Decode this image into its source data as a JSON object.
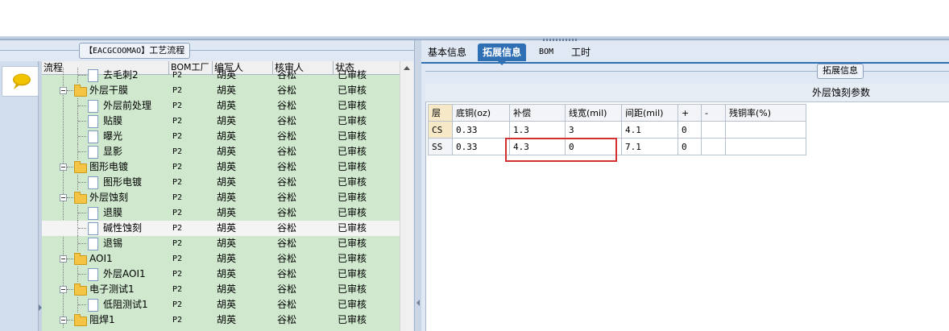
{
  "left_panel": {
    "title_bracket": "【EACGCOOMAO】",
    "title_text": "工艺流程",
    "columns": [
      "流程",
      "BOM工厂",
      "编写人",
      "核审人",
      "状态"
    ],
    "rows": [
      {
        "name": "去毛刺2",
        "level": 2,
        "type": "doc",
        "bom": "P2",
        "writer": "胡英",
        "reviewer": "谷松",
        "status": "已审核"
      },
      {
        "name": "外层干膜",
        "level": 1,
        "type": "folder",
        "bom": "P2",
        "writer": "胡英",
        "reviewer": "谷松",
        "status": "已审核"
      },
      {
        "name": "外层前处理",
        "level": 2,
        "type": "doc",
        "bom": "P2",
        "writer": "胡英",
        "reviewer": "谷松",
        "status": "已审核"
      },
      {
        "name": "贴膜",
        "level": 2,
        "type": "doc",
        "bom": "P2",
        "writer": "胡英",
        "reviewer": "谷松",
        "status": "已审核"
      },
      {
        "name": "曝光",
        "level": 2,
        "type": "doc",
        "bom": "P2",
        "writer": "胡英",
        "reviewer": "谷松",
        "status": "已审核"
      },
      {
        "name": "显影",
        "level": 2,
        "type": "doc",
        "bom": "P2",
        "writer": "胡英",
        "reviewer": "谷松",
        "status": "已审核"
      },
      {
        "name": "图形电镀",
        "level": 1,
        "type": "folder",
        "bom": "P2",
        "writer": "胡英",
        "reviewer": "谷松",
        "status": "已审核"
      },
      {
        "name": "图形电镀",
        "level": 2,
        "type": "doc",
        "bom": "P2",
        "writer": "胡英",
        "reviewer": "谷松",
        "status": "已审核"
      },
      {
        "name": "外层蚀刻",
        "level": 1,
        "type": "folder",
        "bom": "P2",
        "writer": "胡英",
        "reviewer": "谷松",
        "status": "已审核"
      },
      {
        "name": "退膜",
        "level": 2,
        "type": "doc",
        "bom": "P2",
        "writer": "胡英",
        "reviewer": "谷松",
        "status": "已审核"
      },
      {
        "name": "碱性蚀刻",
        "level": 2,
        "type": "doc",
        "bom": "P2",
        "writer": "胡英",
        "reviewer": "谷松",
        "status": "已审核",
        "selected": true
      },
      {
        "name": "退锡",
        "level": 2,
        "type": "doc",
        "bom": "P2",
        "writer": "胡英",
        "reviewer": "谷松",
        "status": "已审核"
      },
      {
        "name": "AOI1",
        "level": 1,
        "type": "folder",
        "bom": "P2",
        "writer": "胡英",
        "reviewer": "谷松",
        "status": "已审核"
      },
      {
        "name": "外层AOI1",
        "level": 2,
        "type": "doc",
        "bom": "P2",
        "writer": "胡英",
        "reviewer": "谷松",
        "status": "已审核"
      },
      {
        "name": "电子测试1",
        "level": 1,
        "type": "folder",
        "bom": "P2",
        "writer": "胡英",
        "reviewer": "谷松",
        "status": "已审核"
      },
      {
        "name": "低阻测试1",
        "level": 2,
        "type": "doc",
        "bom": "P2",
        "writer": "胡英",
        "reviewer": "谷松",
        "status": "已审核"
      },
      {
        "name": "阻焊1",
        "level": 1,
        "type": "folder",
        "bom": "P2",
        "writer": "胡英",
        "reviewer": "谷松",
        "status": "已审核"
      }
    ],
    "icons": {
      "chat": "speech-bubble-icon",
      "folder": "folder-icon",
      "doc": "document-icon"
    }
  },
  "right_panel": {
    "tabs": [
      {
        "label": "基本信息",
        "active": false
      },
      {
        "label": "拓展信息",
        "active": true
      },
      {
        "label": "BOM",
        "active": false
      },
      {
        "label": "工时",
        "active": false
      }
    ],
    "section_title": "拓展信息",
    "grid_caption": "外层蚀刻参数",
    "grid": {
      "columns": [
        "层",
        "底铜(oz)",
        "补偿",
        "线宽(mil)",
        "间距(mil)",
        "+",
        "-",
        "残铜率(%)"
      ],
      "rows": [
        [
          "CS",
          "0.33",
          "1.3",
          "3",
          "4.1",
          "0",
          "",
          ""
        ],
        [
          "SS",
          "0.33",
          "4.3",
          "0",
          "7.1",
          "0",
          "",
          ""
        ]
      ]
    }
  },
  "colors": {
    "accent": "#2f6fb3",
    "tree_bg": "#cfe8ce",
    "highlight_box": "#d43030"
  }
}
